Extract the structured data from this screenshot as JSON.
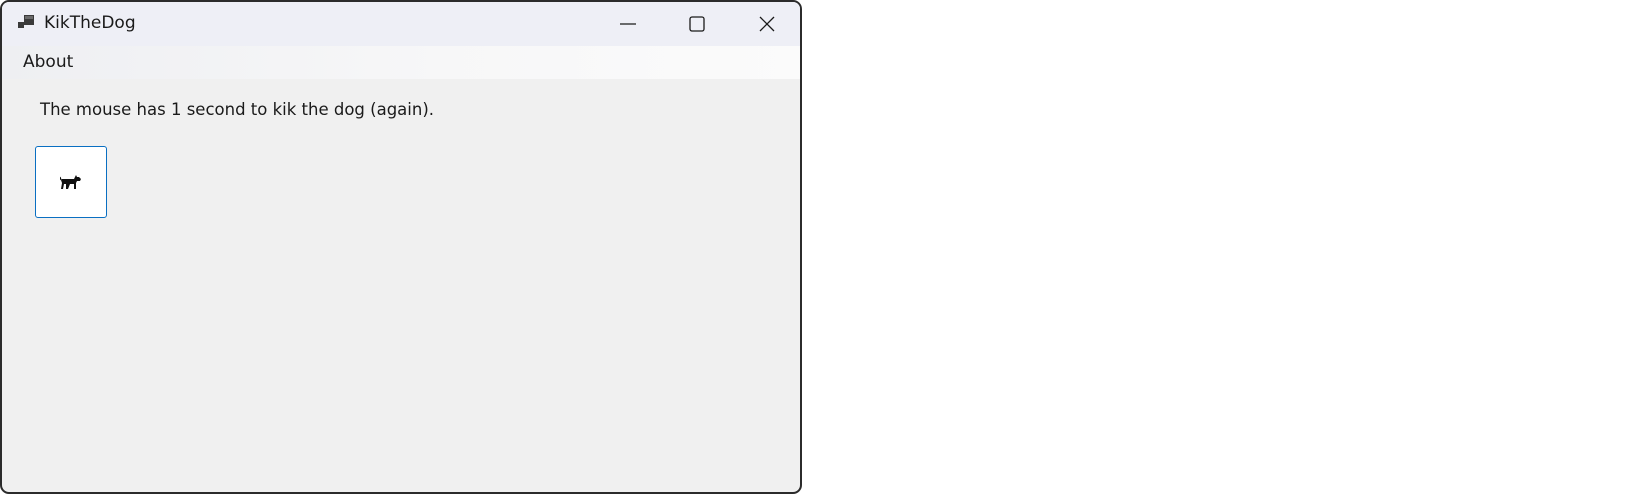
{
  "window": {
    "title": "KikTheDog",
    "app_icon": "app-window-icon",
    "controls": {
      "minimize_icon": "minimize-icon",
      "maximize_icon": "maximize-icon",
      "close_icon": "close-icon"
    }
  },
  "menu": {
    "items": [
      {
        "label": "About"
      }
    ]
  },
  "main": {
    "message": "The mouse has 1 second to kik the dog (again).",
    "dog_button": {
      "icon": "dog-icon"
    }
  },
  "colors": {
    "titlebar_bg": "#eeeff6",
    "client_bg": "#f0f0f0",
    "button_border": "#0a6fc2"
  }
}
